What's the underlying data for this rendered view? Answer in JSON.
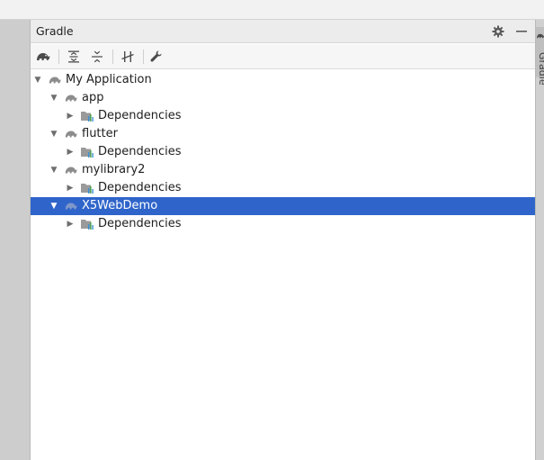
{
  "panel": {
    "title": "Gradle",
    "settings_icon": "gear-icon",
    "hide_icon": "minimize-icon"
  },
  "toolbar": {
    "buttons": [
      {
        "icon": "gradle-elephant-icon",
        "name": "refresh-gradle-button"
      },
      {
        "icon": "expand-all-icon",
        "name": "expand-all-button"
      },
      {
        "icon": "collapse-all-icon",
        "name": "collapse-all-button"
      },
      {
        "icon": "toggle-offline-icon",
        "name": "offline-mode-button"
      },
      {
        "icon": "wrench-icon",
        "name": "build-settings-button"
      }
    ]
  },
  "tree": {
    "root": {
      "label": "My Application",
      "expanded": true
    },
    "modules": [
      {
        "label": "app",
        "expanded": true,
        "child": "Dependencies",
        "selected": false
      },
      {
        "label": "flutter",
        "expanded": true,
        "child": "Dependencies",
        "selected": false
      },
      {
        "label": "mylibrary2",
        "expanded": true,
        "child": "Dependencies",
        "selected": false
      },
      {
        "label": "X5WebDemo",
        "expanded": true,
        "child": "Dependencies",
        "selected": true
      }
    ]
  },
  "side_tab": {
    "label": "Gradle"
  },
  "colors": {
    "selection": "#2f65ca",
    "icon_gray": "#8c8c8c"
  }
}
